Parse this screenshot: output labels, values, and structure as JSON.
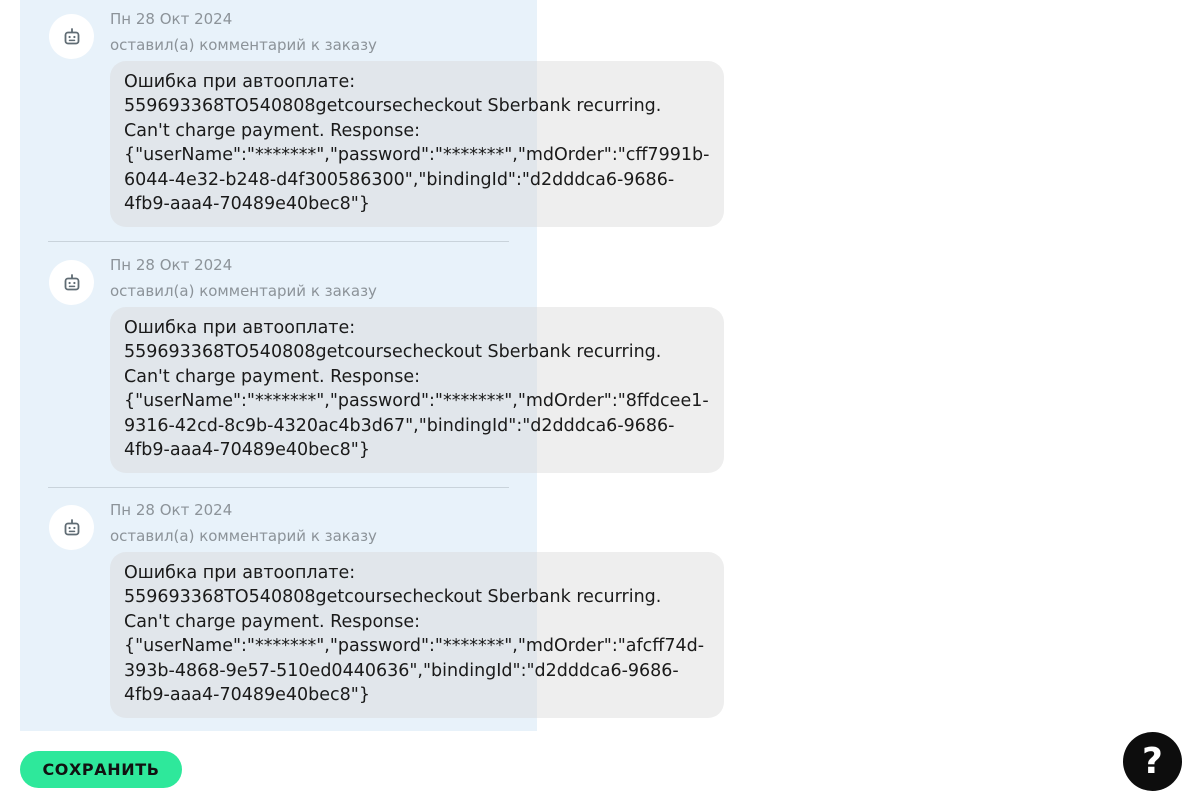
{
  "comments": [
    {
      "author_icon": "robot-icon",
      "date": "Пн 28 Окт 2024",
      "action": "оставил(а) комментарий к заказу",
      "message_lines": [
        "Ошибка при автооплате:",
        "559693368TO540808getcoursecheckout Sberbank recurring.",
        "Can't charge payment. Response:",
        "{\"userName\":\"*******\",\"password\":\"*******\",\"mdOrder\":\"cff7991b-",
        "6044-4e32-b248-d4f300586300\",\"bindingId\":\"d2dddca6-9686-",
        "4fb9-aaa4-70489e40bec8\"}"
      ]
    },
    {
      "author_icon": "robot-icon",
      "date": "Пн 28 Окт 2024",
      "action": "оставил(а) комментарий к заказу",
      "message_lines": [
        "Ошибка при автооплате:",
        "559693368TO540808getcoursecheckout Sberbank recurring.",
        "Can't charge payment. Response:",
        "{\"userName\":\"*******\",\"password\":\"*******\",\"mdOrder\":\"8ffdcee1-",
        "9316-42cd-8c9b-4320ac4b3d67\",\"bindingId\":\"d2dddca6-9686-",
        "4fb9-aaa4-70489e40bec8\"}"
      ]
    },
    {
      "author_icon": "robot-icon",
      "date": "Пн 28 Окт 2024",
      "action": "оставил(а) комментарий к заказу",
      "message_lines": [
        "Ошибка при автооплате:",
        "559693368TO540808getcoursecheckout Sberbank recurring.",
        "Can't charge payment. Response:",
        "{\"userName\":\"*******\",\"password\":\"*******\",\"mdOrder\":\"afcff74d-",
        "393b-4868-9e57-510ed0440636\",\"bindingId\":\"d2dddca6-9686-",
        "4fb9-aaa4-70489e40bec8\"}"
      ]
    }
  ],
  "footer": {
    "save_label": "СОХРАНИТЬ",
    "help_label": "?",
    "help_icon": "question-icon"
  },
  "colors": {
    "panel_background": "#e8f2fa",
    "save_button": "#2ee89b",
    "help_button": "#0d0d0d",
    "meta_text": "#8c9399"
  }
}
